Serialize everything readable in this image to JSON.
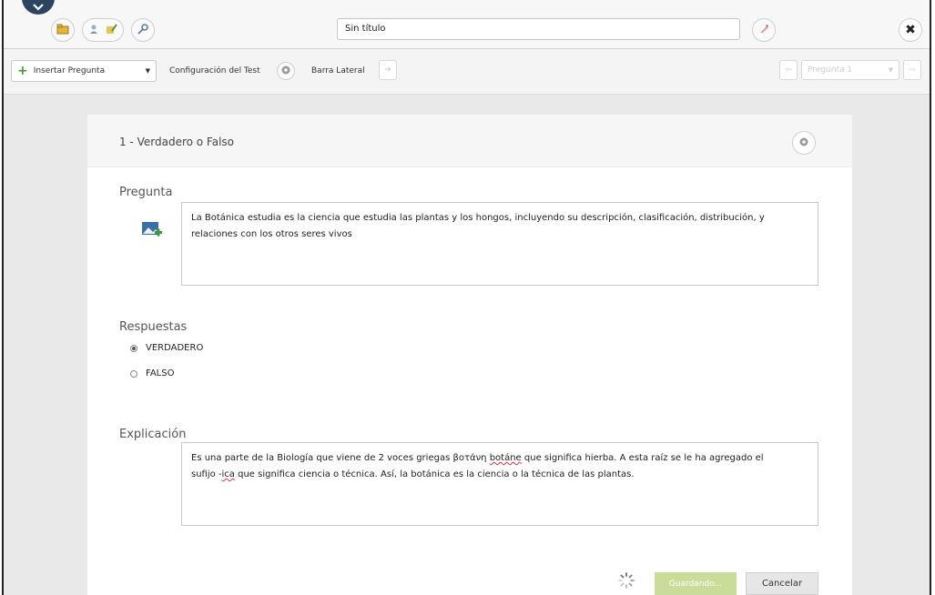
{
  "titlebar": {
    "title_value": "Sin título",
    "icons": [
      "collapse-chevron-icon",
      "folder-icon",
      "people-icon",
      "key-icon",
      "tag-icon",
      "close-icon"
    ],
    "close_label": "✖"
  },
  "toolbar": {
    "insert_question_label": "Insertar Pregunta",
    "test_config_label": "Configuración del Test",
    "sidebar_label": "Barra Lateral",
    "question_selector_value": "Pregunta 1"
  },
  "question": {
    "header_title": "1 - Verdadero o Falso",
    "prompt_label": "Pregunta",
    "prompt_text": "La Botánica estudia es la ciencia que estudia las plantas y los hongos, incluyendo su descripción, clasificación, distribución, y relaciones con los otros seres vivos",
    "answers_label": "Respuestas",
    "answers": [
      {
        "label": "VERDADERO",
        "selected": true
      },
      {
        "label": "FALSO",
        "selected": false
      }
    ],
    "explanation_label": "Explicación",
    "explanation_line1_a": "Es una parte de la Biología que viene de 2 voces griegas βοτάνη ",
    "explanation_line1_b": "botáne",
    "explanation_line1_c": " que significa hierba. A esta raíz se le ha agregado el",
    "explanation_line2_a": "sufijo -",
    "explanation_line2_b": "ica",
    "explanation_line2_c": " que significa ciencia o técnica. Así, la botánica es la ciencia o la técnica de las plantas."
  },
  "actions": {
    "save_label": "Guardando...",
    "cancel_label": "Cancelar"
  },
  "colors": {
    "accent_dark": "#2c4460",
    "save_green": "#c9dc9a",
    "add_green": "#3c9a3c"
  }
}
